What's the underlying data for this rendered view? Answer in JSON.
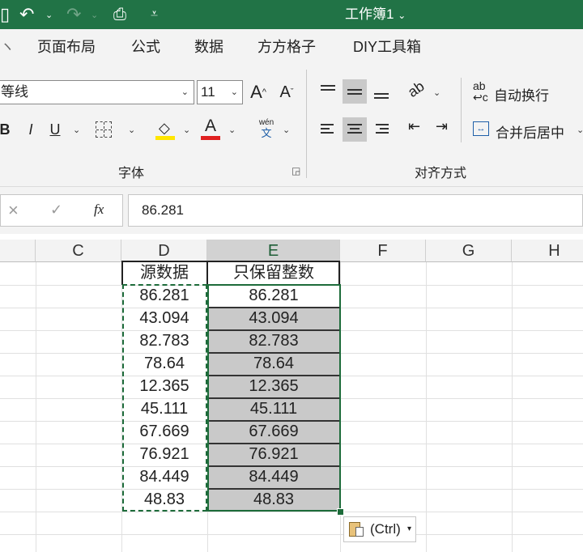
{
  "app": {
    "title": "工作簿1",
    "brand_color": "#217346"
  },
  "ribbon": {
    "tabs": [
      "页面布局",
      "公式",
      "数据",
      "方方格子",
      "DIY工具箱"
    ],
    "font_name": "等线",
    "font_size": "11",
    "grow_font": "A",
    "shrink_font": "A",
    "bold": "B",
    "italic": "I",
    "underline": "U",
    "phonetic_top": "wén",
    "phonetic_bottom": "文",
    "font_group_label": "字体",
    "wrap_text_label": "自动换行",
    "merge_center_label": "合并后居中",
    "align_group_label": "对齐方式",
    "font_color": "#e02020",
    "highlight_color": "#ffe600"
  },
  "formula_bar": {
    "cancel": "×",
    "enter": "✓",
    "fx": "fx",
    "value": "86.281"
  },
  "sheet": {
    "columns": [
      "C",
      "D",
      "E",
      "F",
      "G",
      "H"
    ],
    "header_d": "源数据",
    "header_e": "只保留整数",
    "source_values": [
      "86.281",
      "43.094",
      "82.783",
      "78.64",
      "12.365",
      "45.111",
      "67.669",
      "76.921",
      "84.449",
      "48.83"
    ],
    "result_values": [
      "86.281",
      "43.094",
      "82.783",
      "78.64",
      "12.365",
      "45.111",
      "67.669",
      "76.921",
      "84.449",
      "48.83"
    ]
  },
  "paste_options": {
    "label": "(Ctrl)"
  }
}
